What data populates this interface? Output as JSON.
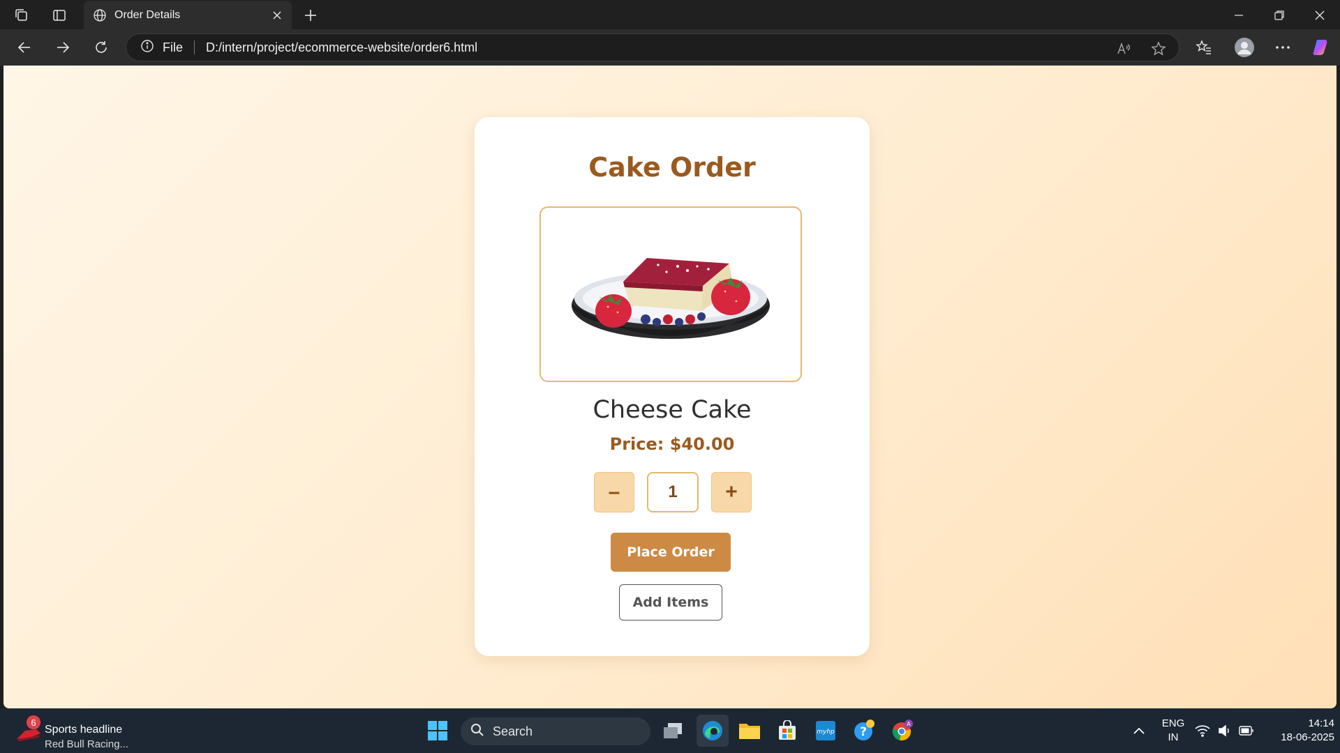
{
  "browser": {
    "tab_title": "Order Details",
    "address_label": "File",
    "url": "D:/intern/project/ecommerce-website/order6.html"
  },
  "order": {
    "title": "Cake Order",
    "product_name": "Cheese Cake",
    "price": "Price: $40.00",
    "quantity": "1",
    "minus_label": "–",
    "plus_label": "+",
    "place_order_label": "Place Order",
    "add_items_label": "Add Items",
    "image_icon": "cheesecake-image"
  },
  "taskbar": {
    "news_badge": "6",
    "news_headline": "Sports headline",
    "news_sub": "Red Bull Racing...",
    "search_placeholder": "Search",
    "lang_top": "ENG",
    "lang_bottom": "IN",
    "time": "14:14",
    "date": "18-06-2025"
  },
  "colors": {
    "accent": "#9a5a1f",
    "button": "#cc8a45",
    "qty_button": "#f8d8a8",
    "border": "#e7b76b"
  }
}
